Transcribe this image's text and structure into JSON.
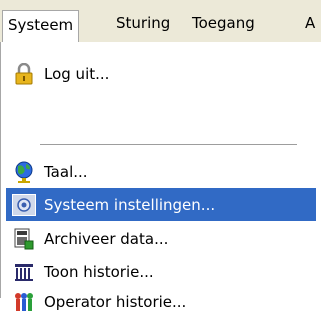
{
  "menubar": {
    "items": [
      {
        "label": "Systeem"
      },
      {
        "label": "Sturing"
      },
      {
        "label": "Toegang"
      },
      {
        "label": "A"
      }
    ]
  },
  "menu": {
    "items": [
      {
        "label": "Log uit...",
        "icon": "padlock-icon"
      },
      {
        "label": "Taal...",
        "icon": "globe-icon"
      },
      {
        "label": "Systeem instellingen...",
        "icon": "settings-icon",
        "selected": true
      },
      {
        "label": "Archiveer data...",
        "icon": "archive-icon"
      },
      {
        "label": "Toon historie...",
        "icon": "history-icon"
      },
      {
        "label": "Operator historie...",
        "icon": "operator-history-icon"
      }
    ]
  }
}
